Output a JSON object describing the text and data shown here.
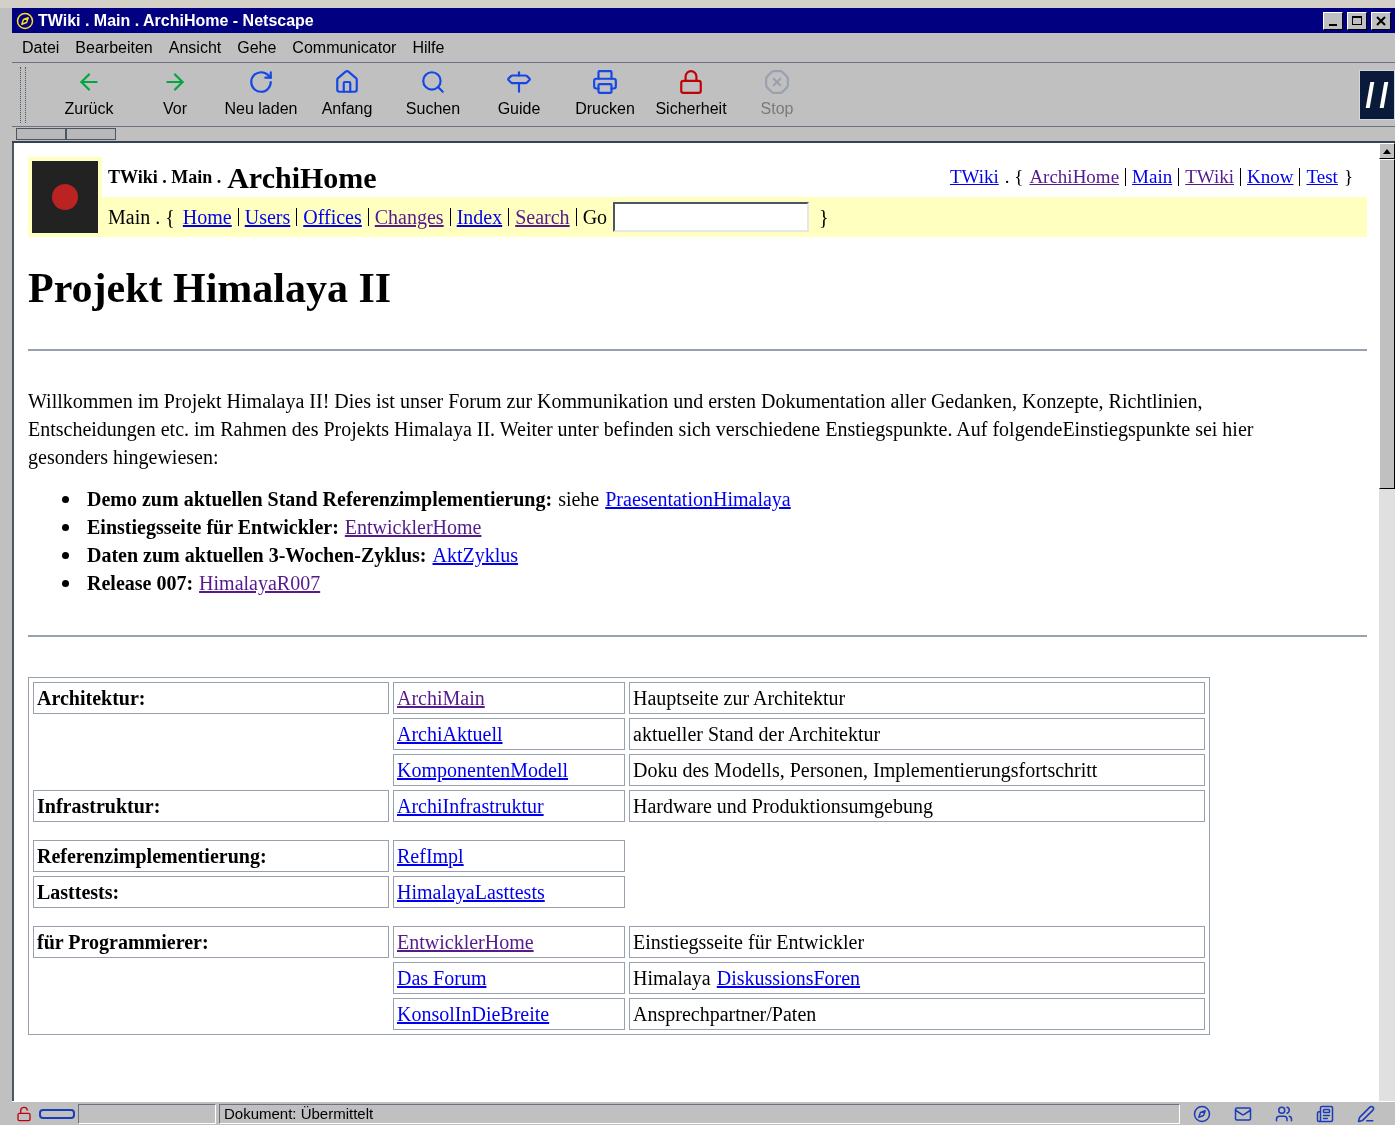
{
  "window": {
    "title": "TWiki . Main . ArchiHome - Netscape"
  },
  "menu": [
    "Datei",
    "Bearbeiten",
    "Ansicht",
    "Gehe",
    "Communicator",
    "Hilfe"
  ],
  "toolbar": [
    {
      "kind": "back",
      "label": "Zurück",
      "disabled": false
    },
    {
      "kind": "forward",
      "label": "Vor",
      "disabled": false
    },
    {
      "kind": "reload",
      "label": "Neu laden",
      "disabled": false
    },
    {
      "kind": "home",
      "label": "Anfang",
      "disabled": false
    },
    {
      "kind": "search",
      "label": "Suchen",
      "disabled": false
    },
    {
      "kind": "guide",
      "label": "Guide",
      "disabled": false
    },
    {
      "kind": "print",
      "label": "Drucken",
      "disabled": false
    },
    {
      "kind": "security",
      "label": "Sicherheit",
      "disabled": false
    },
    {
      "kind": "stop",
      "label": "Stop",
      "disabled": true
    }
  ],
  "header": {
    "breadcrumb": "TWiki . Main .",
    "topic": "ArchiHome",
    "web_link": {
      "text": "TWiki",
      "visited": false
    },
    "web_open": ". {",
    "webs": [
      {
        "text": "ArchiHome",
        "visited": true
      },
      {
        "text": "Main",
        "visited": false
      },
      {
        "text": "TWiki",
        "visited": true
      },
      {
        "text": "Know",
        "visited": false
      },
      {
        "text": "Test",
        "visited": false
      }
    ],
    "web_close": "}",
    "nav_prefix": "Main . {",
    "nav": [
      {
        "text": "Home",
        "visited": false
      },
      {
        "text": "Users",
        "visited": false
      },
      {
        "text": "Offices",
        "visited": false
      },
      {
        "text": "Changes",
        "visited": true
      },
      {
        "text": "Index",
        "visited": false
      },
      {
        "text": "Search",
        "visited": true
      }
    ],
    "go_label": "Go",
    "nav_close": "}"
  },
  "heading": "Projekt Himalaya II",
  "intro": "Willkommen im Projekt Himalaya II! Dies ist unser Forum zur Kommunikation und ersten Dokumentation aller Gedanken, Konzepte, Richtlinien, Entscheidungen etc. im Rahmen des Projekts Himalaya II. Weiter unter befinden sich verschiedene Enstiegspunkte. Auf folgendeEinstiegspunkte sei hier gesonders hingewiesen:",
  "bullets": [
    {
      "label": "Demo zum aktuellen Stand Referenzimplementierung:",
      "text": "siehe",
      "link": {
        "text": "PraesentationHimalaya",
        "visited": false
      }
    },
    {
      "label": "Einstiegsseite für Entwickler:",
      "link": {
        "text": "EntwicklerHome",
        "visited": true
      }
    },
    {
      "label": "Daten zum aktuellen 3-Wochen-Zyklus:",
      "link": {
        "text": "AktZyklus",
        "visited": false
      }
    },
    {
      "label": "Release 007:",
      "link": {
        "text": "HimalayaR007",
        "visited": true
      }
    }
  ],
  "table": {
    "groups": [
      {
        "rows": [
          {
            "label": "Architektur:",
            "link": {
              "text": "ArchiMain",
              "visited": true
            },
            "description": [
              {
                "kind": "text",
                "text": "Hauptseite zur Architektur"
              }
            ]
          },
          {
            "link": {
              "text": "ArchiAktuell",
              "visited": false
            },
            "description": [
              {
                "kind": "text",
                "text": "aktueller Stand der Architektur"
              }
            ]
          },
          {
            "link": {
              "text": "KomponentenModell",
              "visited": false
            },
            "description": [
              {
                "kind": "text",
                "text": "Doku des Modells, Personen, Implementierungsfortschritt"
              }
            ]
          },
          {
            "label": "Infrastruktur:",
            "link": {
              "text": "ArchiInfrastruktur",
              "visited": false
            },
            "description": [
              {
                "kind": "text",
                "text": "Hardware und Produktionsumgebung"
              }
            ]
          }
        ]
      },
      {
        "rows": [
          {
            "label": "Referenzimplementierung:",
            "link": {
              "text": "RefImpl",
              "visited": false
            }
          },
          {
            "label": "Lasttests:",
            "link": {
              "text": "HimalayaLasttests",
              "visited": false
            }
          }
        ]
      },
      {
        "rows": [
          {
            "label": "für Programmierer:",
            "link": {
              "text": "EntwicklerHome",
              "visited": true
            },
            "description": [
              {
                "kind": "text",
                "text": "Einstiegsseite für Entwickler"
              }
            ]
          },
          {
            "link": {
              "text": "Das Forum",
              "visited": false
            },
            "description": [
              {
                "kind": "text",
                "text": "Himalaya"
              },
              {
                "kind": "link",
                "text": "DiskussionsForen",
                "visited": false
              }
            ]
          },
          {
            "link": {
              "text": "KonsolInDieBreite",
              "visited": false
            },
            "description": [
              {
                "kind": "text",
                "text": "Ansprechpartner/Paten"
              }
            ]
          }
        ]
      }
    ]
  },
  "status_bar": {
    "text": "Dokument: Übermittelt"
  }
}
